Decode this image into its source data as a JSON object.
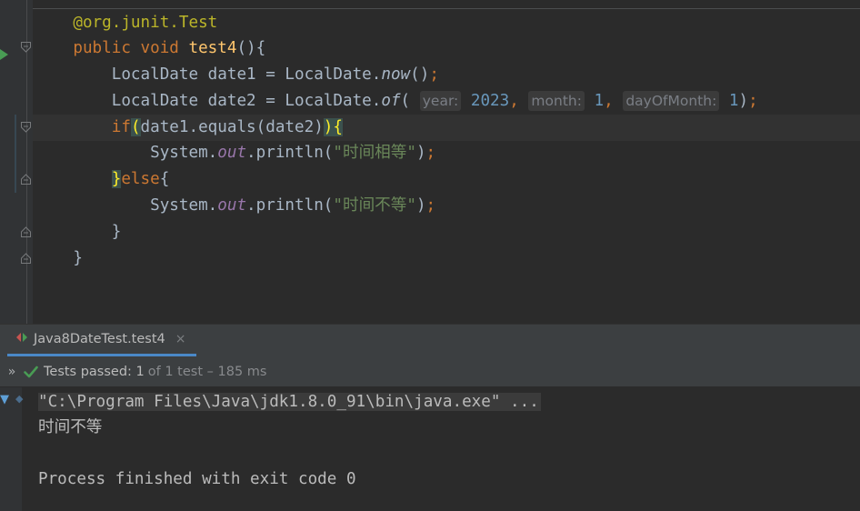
{
  "editor": {
    "lines": {
      "annotation": "@org.junit.Test",
      "method_kw1": "public",
      "method_kw2": "void",
      "method_name": "test4",
      "method_tail": "(){",
      "date1_type": "LocalDate",
      "date1_name": " date1 = LocalDate.",
      "date1_call": "now",
      "date1_tail": "()",
      "date1_semi": ";",
      "date2_type": "LocalDate",
      "date2_name": " date2 = LocalDate.",
      "date2_call": "of",
      "date2_open": "( ",
      "hint_year": "year:",
      "year_val": "2023",
      "comma": ",",
      "hint_month": "month:",
      "month_val": "1",
      "hint_day": "dayOfMonth:",
      "day_val": "1",
      "date2_close": ")",
      "if_kw": "if",
      "if_open": "(",
      "if_cond": "date1.equals(date2)",
      "if_close": ")",
      "if_brace": "{",
      "println1_obj": "System.",
      "println1_field": "out",
      "println1_call": ".println(",
      "println1_str": "\"时间相等\"",
      "println1_tail": ")",
      "else_brace": "}",
      "else_kw": "else",
      "else_open": "{",
      "println2_obj": "System.",
      "println2_field": "out",
      "println2_call": ".println(",
      "println2_str": "\"时间不等\"",
      "println2_tail": ")",
      "close_inner": "}",
      "close_outer": "}"
    }
  },
  "run_panel": {
    "tab_label": "Java8DateTest.test4",
    "tab_close": "×",
    "expand": "»",
    "status_bold": "Tests passed: 1",
    "status_light": "of 1 test – 185 ms",
    "console_lines": {
      "command": "\"C:\\Program Files\\Java\\jdk1.8.0_91\\bin\\java.exe\" ...",
      "output": "时间不等",
      "exit": "Process finished with exit code 0"
    }
  },
  "colors": {
    "keyword": "#cc7832",
    "function": "#ffc66d",
    "annotation": "#bbb529",
    "number": "#6897bb",
    "string": "#6a8759",
    "field": "#9876aa",
    "pass": "#499c54",
    "tab_underline": "#4a88c7"
  },
  "icons": {
    "run": "run-gutter-icon",
    "fold": "fold-marker-icon",
    "check": "check-icon",
    "expand": "expand-icon",
    "tab": "test-run-icon"
  }
}
